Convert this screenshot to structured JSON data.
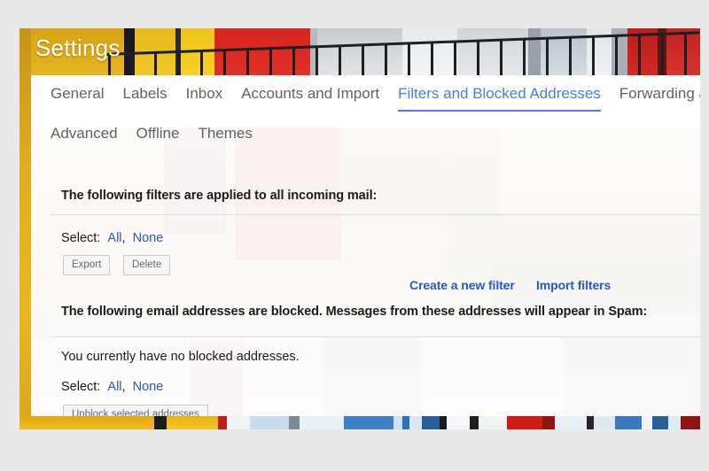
{
  "window": {
    "banner_title": "Settings",
    "accent_gold": "#e0ae1e",
    "link_blue": "#2b56c4",
    "tab_active_blue": "#4b7be5"
  },
  "tabs": {
    "row1": [
      {
        "label": "General",
        "active": false
      },
      {
        "label": "Labels",
        "active": false
      },
      {
        "label": "Inbox",
        "active": false
      },
      {
        "label": "Accounts and Import",
        "active": false
      },
      {
        "label": "Filters and Blocked Addresses",
        "active": true
      },
      {
        "label": "Forwarding and",
        "active": false
      }
    ],
    "row2": [
      {
        "label": "Advanced",
        "active": false
      },
      {
        "label": "Offline",
        "active": false
      },
      {
        "label": "Themes",
        "active": false
      }
    ]
  },
  "filters_section": {
    "heading": "The following filters are applied to all incoming mail:",
    "select_label": "Select:",
    "select_all": "All",
    "select_separator": ",",
    "select_none": "None",
    "export_button": "Export",
    "delete_button": "Delete",
    "create_filter_link": "Create a new filter",
    "import_filters_link": "Import filters"
  },
  "blocked_section": {
    "heading": "The following email addresses are blocked. Messages from these addresses will appear in Spam:",
    "empty_message": "You currently have no blocked addresses.",
    "select_label": "Select:",
    "select_all": "All",
    "select_separator": ",",
    "select_none": "None",
    "unblock_button": "Unblock selected addresses"
  }
}
